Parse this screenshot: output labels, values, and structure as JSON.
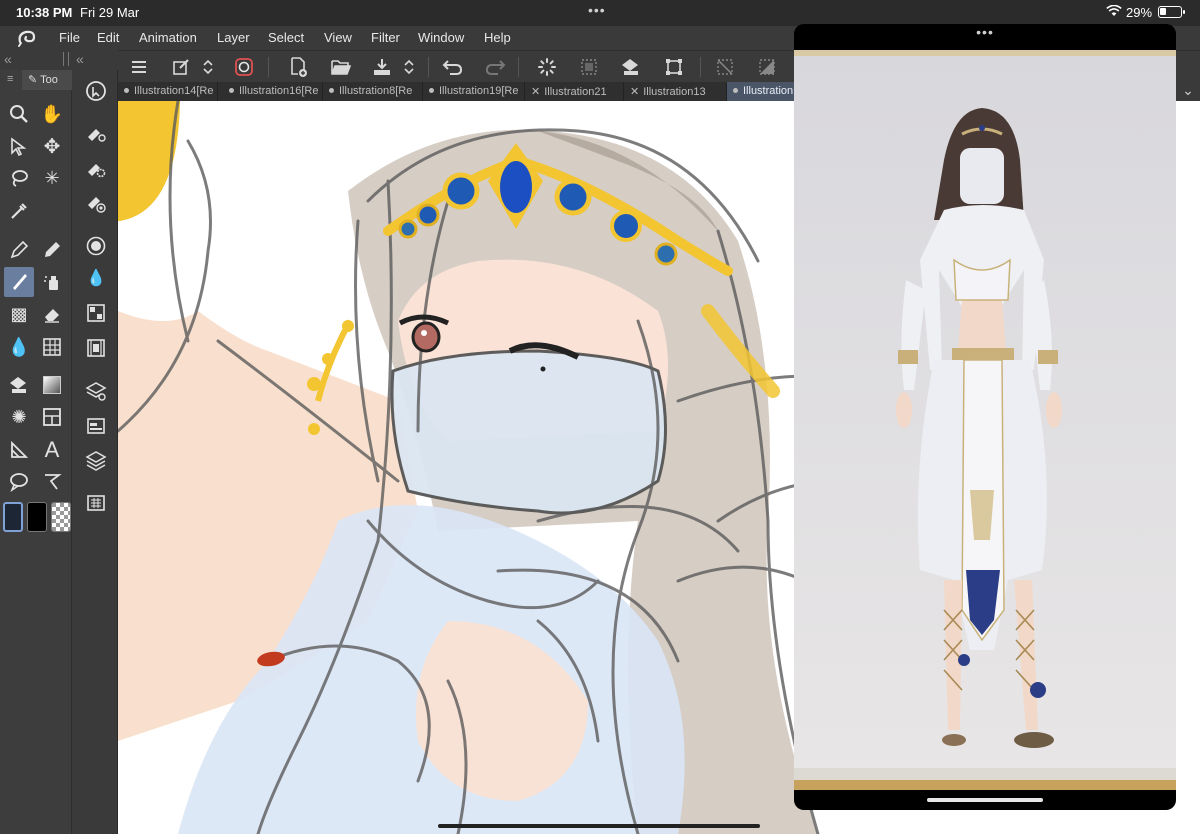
{
  "status": {
    "time": "10:38 PM",
    "date": "Fri 29 Mar",
    "dots": "•••",
    "battery_pct": "29%",
    "battery_level": 0.29
  },
  "menu": {
    "items": [
      "File",
      "Edit",
      "Animation",
      "Layer",
      "Select",
      "View",
      "Filter",
      "Window",
      "Help"
    ]
  },
  "dock": {
    "collapse_left": "«",
    "panel_title": "Too"
  },
  "tabs": [
    {
      "label": "Illustration14[Re",
      "kind": "bullet"
    },
    {
      "label": "Illustration16[Re",
      "kind": "bullet"
    },
    {
      "label": "Illustration8[Re",
      "kind": "bullet"
    },
    {
      "label": "Illustration19[Re",
      "kind": "bullet"
    },
    {
      "label": "Illustration21",
      "kind": "close"
    },
    {
      "label": "Illustration13",
      "kind": "close"
    },
    {
      "label": "Illustration",
      "kind": "bullet"
    }
  ],
  "tab_close_glyph": "✕",
  "right_dock": {
    "chevron": "⌄"
  },
  "reference_window": {
    "grabber": "•••"
  },
  "colors": {
    "chrome": "#3a3a3a",
    "active_tool": "#6a7ea0",
    "active_tab": "#4a5668",
    "main_color": "#1d2634",
    "sub_color": "#000000",
    "accent_gold": "#f2c531",
    "accent_blue": "#1f5ab5"
  },
  "icons": {
    "toolbar": [
      "menu-icon",
      "new-canvas-icon",
      "stepper-icon",
      "clip-studio-icon",
      "new-file-icon",
      "open-folder-icon",
      "save-icon",
      "stepper-icon",
      "undo-icon",
      "redo-icon",
      "loading-icon",
      "transparency-icon",
      "fill-icon",
      "transform-icon",
      "deselect-icon",
      "invert-icon"
    ],
    "tools": [
      "zoom-icon",
      "hand-icon",
      "object-icon",
      "move-icon",
      "lasso-icon",
      "magic-wand-icon",
      "eyedropper-icon",
      "pen-icon",
      "pencil-icon",
      "brush-icon",
      "airbrush-icon",
      "decoration-icon",
      "eraser-icon",
      "blend-icon",
      "ruler-icon",
      "fill-icon",
      "gradient-icon",
      "figure-icon",
      "frame-icon",
      "balloon-icon",
      "text-icon",
      "speech-icon",
      "correct-line-icon"
    ]
  }
}
